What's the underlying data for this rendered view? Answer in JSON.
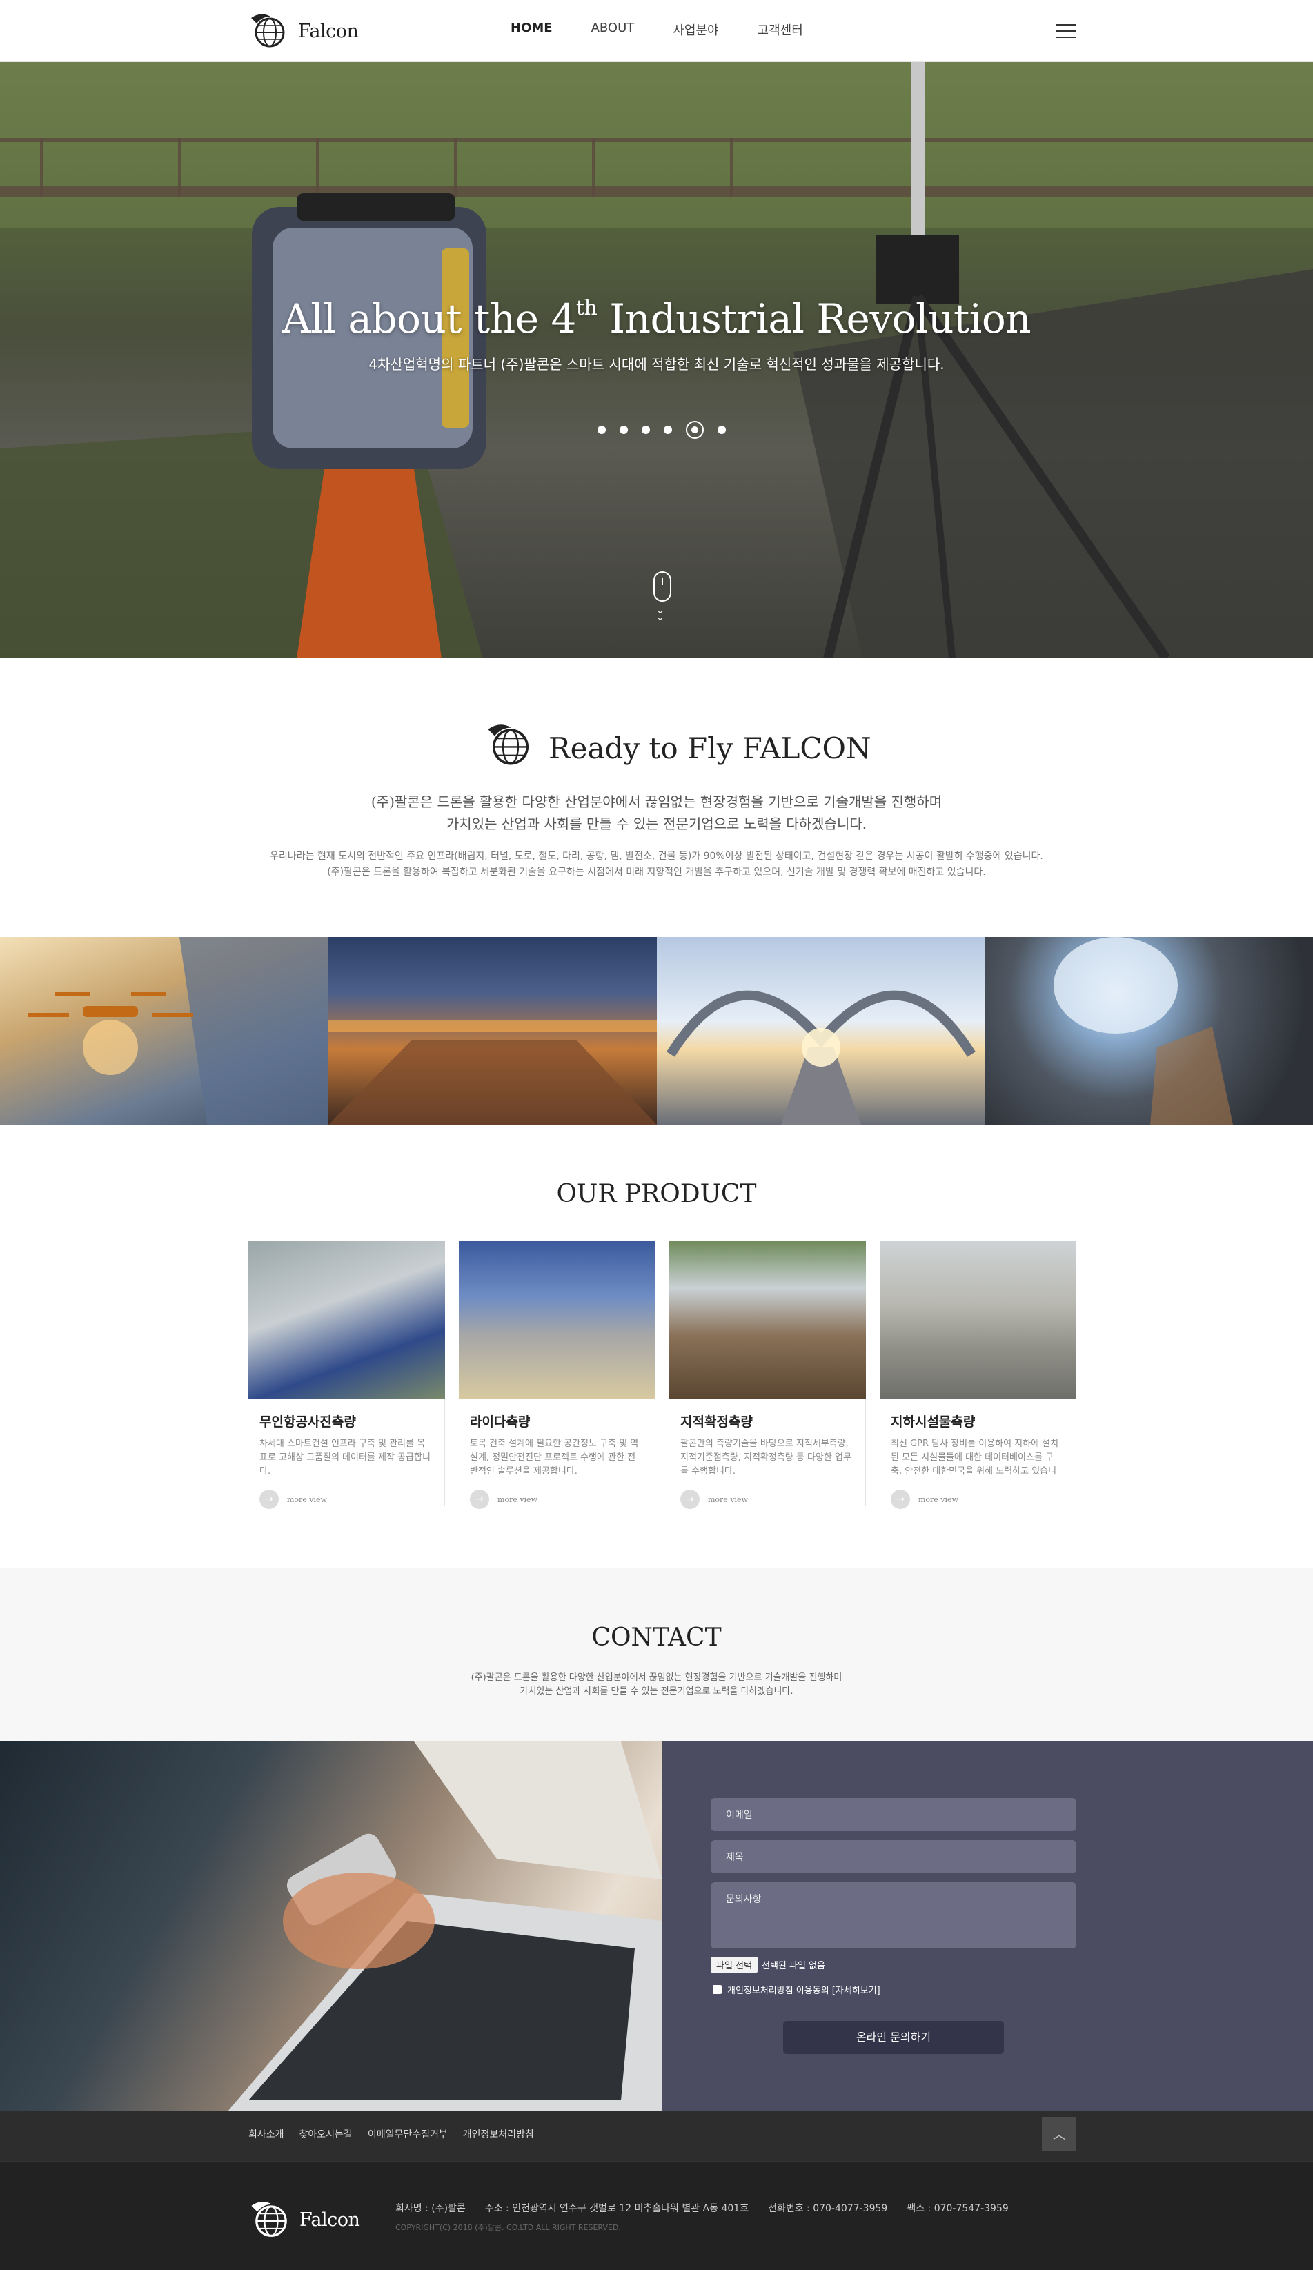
{
  "header": {
    "logo_text": "Falcon",
    "nav": [
      "HOME",
      "ABOUT",
      "사업분야",
      "고객센터"
    ]
  },
  "hero": {
    "title_pre": "All about the 4",
    "title_sup": "th",
    "title_post": " Industrial Revolution",
    "subtitle": "4차산업혁명의 파트너 (주)팔콘은 스마트 시대에 적합한 최신 기술로 혁신적인 성과물을 제공합니다.",
    "slide_count": 6,
    "active_slide": 5
  },
  "intro": {
    "title": "Ready to Fly FALCON",
    "lead_1": "(주)팔콘은 드론을 활용한 다양한 산업분야에서 끊임없는 현장경험을 기반으로 기술개발을 진행하며",
    "lead_2": "가치있는 산업과 사회를 만들 수 있는 전문기업으로 노력을 다하겠습니다.",
    "body_1": "우리나라는 현재 도시의 전반적인 주요 인프라(배립지, 터널, 도로, 철도, 다리, 공항, 댐, 발전소, 건물 등)가 90%이상 발전된 상태이고, 건설현장 같은 경우는 시공이 활발히 수행중에 있습니다.",
    "body_2": "(주)팔콘은 드론을 활용하여 복잡하고 세분화된 기술을 요구하는 시점에서 미래 지향적인 개발을 추구하고 있으며, 신기술 개발 및 경쟁력 확보에 매진하고 있습니다."
  },
  "products": {
    "title": "OUR PRODUCT",
    "more_label": "more view",
    "items": [
      {
        "title": "무인항공사진측량",
        "text": "차세대 스마트건설 인프라 구축 및 관리를 목표로 고해상 고품질의 데이터를 제작 공급합니다."
      },
      {
        "title": "라이다측량",
        "text": "토목 건축 설계에 필요한 공간정보 구축 및 역설계, 정밀안전진단 프로젝트 수행에 관한 전반적인 솔루션을 제공합니다."
      },
      {
        "title": "지적확정측량",
        "text": "팔콘만의 측량기술을 바탕으로 지적세부측량, 지적기준점측량, 지적확정측량 등 다양한 업무를 수행합니다."
      },
      {
        "title": "지하시설물측량",
        "text": "최신 GPR 탐사 장비를 이용하여 지하에 설치된 모든 시설물들에 대한 데이터베이스를 구축, 안전한 대한민국을 위해 노력하고 있습니다."
      }
    ]
  },
  "contact": {
    "title": "CONTACT",
    "desc_1": "(주)팔콘은 드론을 활용한 다양한 산업분야에서 끊임없는 현장경험을 기반으로 기술개발을 진행하며",
    "desc_2": "가치있는 산업과 사회를 만들 수 있는 전문기업으로 노력을 다하겠습니다.",
    "email_placeholder": "이메일",
    "subject_placeholder": "제목",
    "message_placeholder": "문의사항",
    "file_button": "파일 선택",
    "file_status": "선택된 파일 없음",
    "agree_label": "개인정보처리방침 이용동의 [자세히보기]",
    "submit_label": "온라인 문의하기"
  },
  "footer": {
    "links": [
      "회사소개",
      "찾아오시는길",
      "이메일무단수집거부",
      "개인정보처리방침"
    ],
    "top_icon": "chevron-up-icon",
    "company": "회사명 : (주)팔콘",
    "address": "주소 : 인천광역시 연수구 갯벌로 12 미추홀타워 별관 A동 401호",
    "phone": "전화번호 : 070-4077-3959",
    "fax": "팩스 : 070-7547-3959",
    "copyright": "COPYRIGHT(C) 2018 (주)팔콘. CO.LTD ALL RIGHT RESERVED."
  }
}
